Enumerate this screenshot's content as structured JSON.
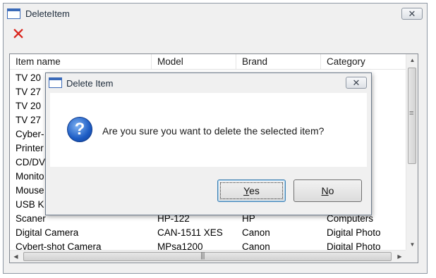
{
  "window": {
    "title": "DeleteItem",
    "close_glyph": "✕",
    "toolbar_delete_glyph": "✕"
  },
  "list": {
    "columns": [
      "Item name",
      "Model",
      "Brand",
      "Category"
    ],
    "rows": [
      {
        "name": "TV 20",
        "model": "",
        "brand": "",
        "category": ""
      },
      {
        "name": "TV 27",
        "model": "",
        "brand": "",
        "category": ""
      },
      {
        "name": "TV 20",
        "model": "",
        "brand": "",
        "category": ""
      },
      {
        "name": "TV 27",
        "model": "",
        "brand": "",
        "category": ""
      },
      {
        "name": "Cyber-",
        "model": "",
        "brand": "",
        "category": "oto"
      },
      {
        "name": "Printer",
        "model": "",
        "brand": "",
        "category": "oto"
      },
      {
        "name": "CD/DV",
        "model": "",
        "brand": "",
        "category": "s"
      },
      {
        "name": "Monito",
        "model": "",
        "brand": "",
        "category": "s"
      },
      {
        "name": "Mouse",
        "model": "",
        "brand": "",
        "category": "s"
      },
      {
        "name": "USB K",
        "model": "",
        "brand": "",
        "category": "s"
      },
      {
        "name": "Scaner",
        "model": "HP-122",
        "brand": "HP",
        "category": "Computers"
      },
      {
        "name": "Digital Camera",
        "model": "CAN-1511 XES",
        "brand": "Canon",
        "category": "Digital Photo"
      },
      {
        "name": "Cybert-shot Camera",
        "model": "MPsa1200",
        "brand": "Canon",
        "category": "Digital Photo"
      }
    ],
    "scroll": {
      "up": "▲",
      "down": "▼",
      "left": "◀",
      "right": "▶"
    }
  },
  "dialog": {
    "title": "Delete Item",
    "close_glyph": "✕",
    "icon_glyph": "?",
    "message": "Are you sure you want to delete the selected item?",
    "yes_prefix": "",
    "yes_accel": "Y",
    "yes_rest": "es",
    "no_prefix": "",
    "no_accel": "N",
    "no_rest": "o"
  }
}
